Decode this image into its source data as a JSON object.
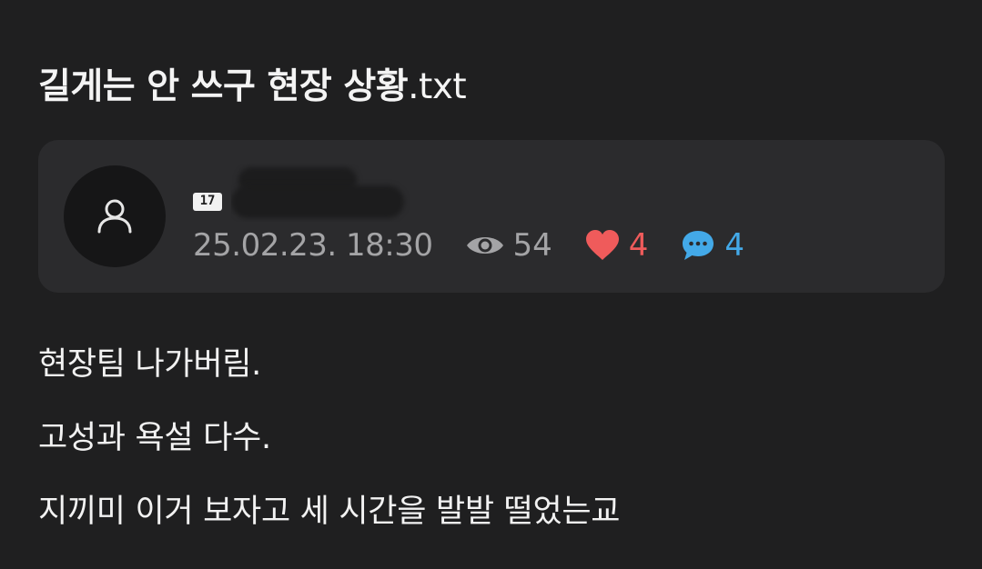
{
  "post": {
    "title_main": "길게는 안 쓰구 현장 상황",
    "title_ext": ".txt"
  },
  "author": {
    "level_badge": "17",
    "name": "",
    "date": "25.02.23. 18:30"
  },
  "stats": {
    "views": "54",
    "likes": "4",
    "comments": "4"
  },
  "content": {
    "lines": [
      "현장팀 나가버림.",
      "고성과 욕설 다수.",
      "지끼미 이거 보자고 세 시간을 발발 떨었는교"
    ]
  },
  "colors": {
    "background": "#1f1f20",
    "card": "#2b2b2d",
    "muted": "#a4a4a6",
    "like": "#ef5b5b",
    "comment": "#43a9e8"
  },
  "icons": {
    "avatar": "user-icon",
    "views": "eye-icon",
    "likes": "heart-icon",
    "comments": "chat-bubble-icon"
  }
}
